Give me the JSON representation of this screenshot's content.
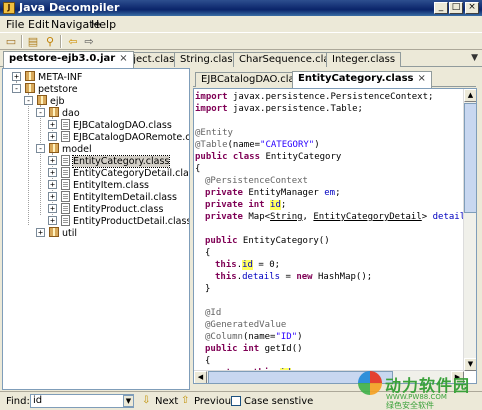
{
  "window": {
    "title": "Java Decompiler",
    "minimize": "_",
    "maximize": "□",
    "close": "×"
  },
  "menu": [
    "File",
    "Edit",
    "Navigate",
    "Help"
  ],
  "file_tabs": {
    "active": "petstore-ejb3.0.jar",
    "others": [
      "Object.class",
      "String.class",
      "CharSequence.class",
      "Integer.class"
    ]
  },
  "tree": {
    "nodes": [
      {
        "label": "META-INF",
        "kind": "package",
        "toggle": "+"
      },
      {
        "label": "petstore",
        "kind": "package",
        "toggle": "-"
      },
      {
        "label": "ejb",
        "kind": "package",
        "toggle": "-"
      },
      {
        "label": "dao",
        "kind": "package",
        "toggle": "-"
      },
      {
        "label": "EJBCatalogDAO.class",
        "kind": "class",
        "toggle": "+"
      },
      {
        "label": "EJBCatalogDAORemote.class",
        "kind": "class",
        "toggle": "+"
      },
      {
        "label": "model",
        "kind": "package",
        "toggle": "-"
      },
      {
        "label": "EntityCategory.class",
        "kind": "class",
        "toggle": "+",
        "selected": true
      },
      {
        "label": "EntityCategoryDetail.class",
        "kind": "class",
        "toggle": "+"
      },
      {
        "label": "EntityItem.class",
        "kind": "class",
        "toggle": "+"
      },
      {
        "label": "EntityItemDetail.class",
        "kind": "class",
        "toggle": "+"
      },
      {
        "label": "EntityProduct.class",
        "kind": "class",
        "toggle": "+"
      },
      {
        "label": "EntityProductDetail.class",
        "kind": "class",
        "toggle": "+"
      },
      {
        "label": "util",
        "kind": "package",
        "toggle": "+"
      }
    ]
  },
  "editor_tabs": {
    "inactive": "EJBCatalogDAO.class",
    "active": "EntityCategory.class",
    "close": "×"
  },
  "code": {
    "import1_kw": "import",
    "import1_rest": " javax.persistence.PersistenceContext;",
    "import2_kw": "import",
    "import2_rest": " javax.persistence.Table;",
    "ann_entity": "@Entity",
    "ann_table": "@Table",
    "ann_table_open": "(name=",
    "ann_table_str": "\"CATEGORY\"",
    "ann_table_close": ")",
    "class_kw": "public class",
    "class_name": " EntityCategory",
    "open_brace": "{",
    "ann_pc": "@PersistenceContext",
    "f1_kw": "private",
    "f1_type": " EntityManager ",
    "f1_name": "em",
    "f1_end": ";",
    "f2_kw": "private int",
    "f2_name": "id",
    "f2_end": ";",
    "f3_kw": "private",
    "f3_type1": " Map<",
    "f3_t1": "String",
    "f3_sep": ", ",
    "f3_t2": "EntityCategoryDetail",
    "f3_type2": "> ",
    "f3_name": "details",
    "f3_end": ";",
    "ctor_kw": "public",
    "ctor_name": " EntityCategory()",
    "ctor_open": "{",
    "l1_this": "this",
    "l1_dot": ".",
    "l1_id": "id",
    "l1_rest": " = 0;",
    "l2_this": "this",
    "l2_dot": ".",
    "l2_field": "details",
    "l2_eq": " = ",
    "l2_new": "new",
    "l2_rest": " HashMap();",
    "ctor_close": "}",
    "ann_id": "@Id",
    "ann_gen": "@GeneratedValue",
    "ann_col": "@Column",
    "ann_col_open": "(name=",
    "ann_col_str": "\"ID\"",
    "ann_col_close": ")",
    "get_kw": "public int",
    "get_name": " getId()",
    "get_open": "{",
    "ret_kw": "return",
    "ret_this": "this",
    "ret_dot": ".",
    "ret_id": "id",
    "ret_end": ";"
  },
  "findbar": {
    "label": "Find:",
    "value": "id",
    "next": "Next",
    "previous": "Previous",
    "case_sensitive": "Case senstive"
  },
  "watermark": {
    "text": "动力软件园",
    "url": "WWW.PW88.COM",
    "sub": "绿色安全软件"
  }
}
